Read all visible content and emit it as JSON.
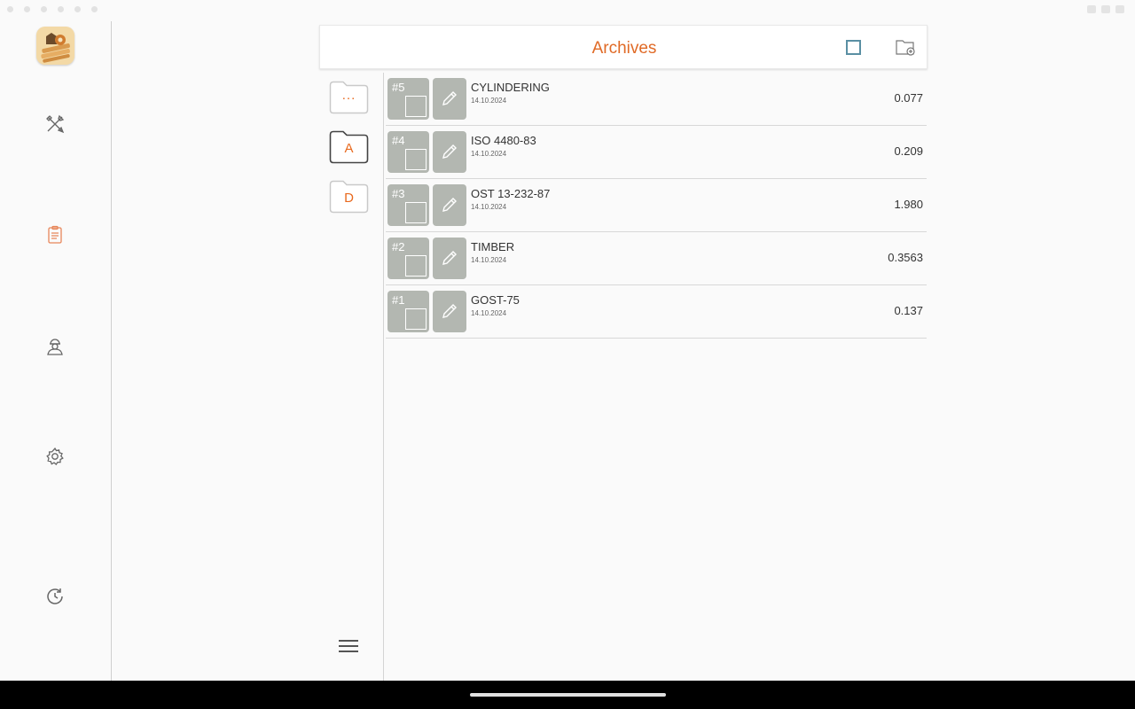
{
  "header": {
    "title": "Archives"
  },
  "folders": [
    {
      "label": "...",
      "active": false
    },
    {
      "label": "A",
      "active": true
    },
    {
      "label": "D",
      "active": false
    }
  ],
  "rows": [
    {
      "index": "#5",
      "name": "CYLINDERING",
      "date": "14.10.2024",
      "value": "0.077"
    },
    {
      "index": "#4",
      "name": "ISO 4480-83",
      "date": "14.10.2024",
      "value": "0.209"
    },
    {
      "index": "#3",
      "name": "OST 13-232-87",
      "date": "14.10.2024",
      "value": "1.980"
    },
    {
      "index": "#2",
      "name": "TIMBER",
      "date": "14.10.2024",
      "value": "0.3563"
    },
    {
      "index": "#1",
      "name": "GOST-75",
      "date": "14.10.2024",
      "value": "0.137"
    }
  ],
  "rail": {
    "items": [
      "logo-icon",
      "tools-icon",
      "clipboard-icon",
      "worker-icon",
      "gear-icon",
      "history-icon"
    ],
    "active": "clipboard-icon"
  },
  "colors": {
    "accent": "#e06a26",
    "tile": "#b3b7b1",
    "checkbox": "#5a8fa3"
  }
}
